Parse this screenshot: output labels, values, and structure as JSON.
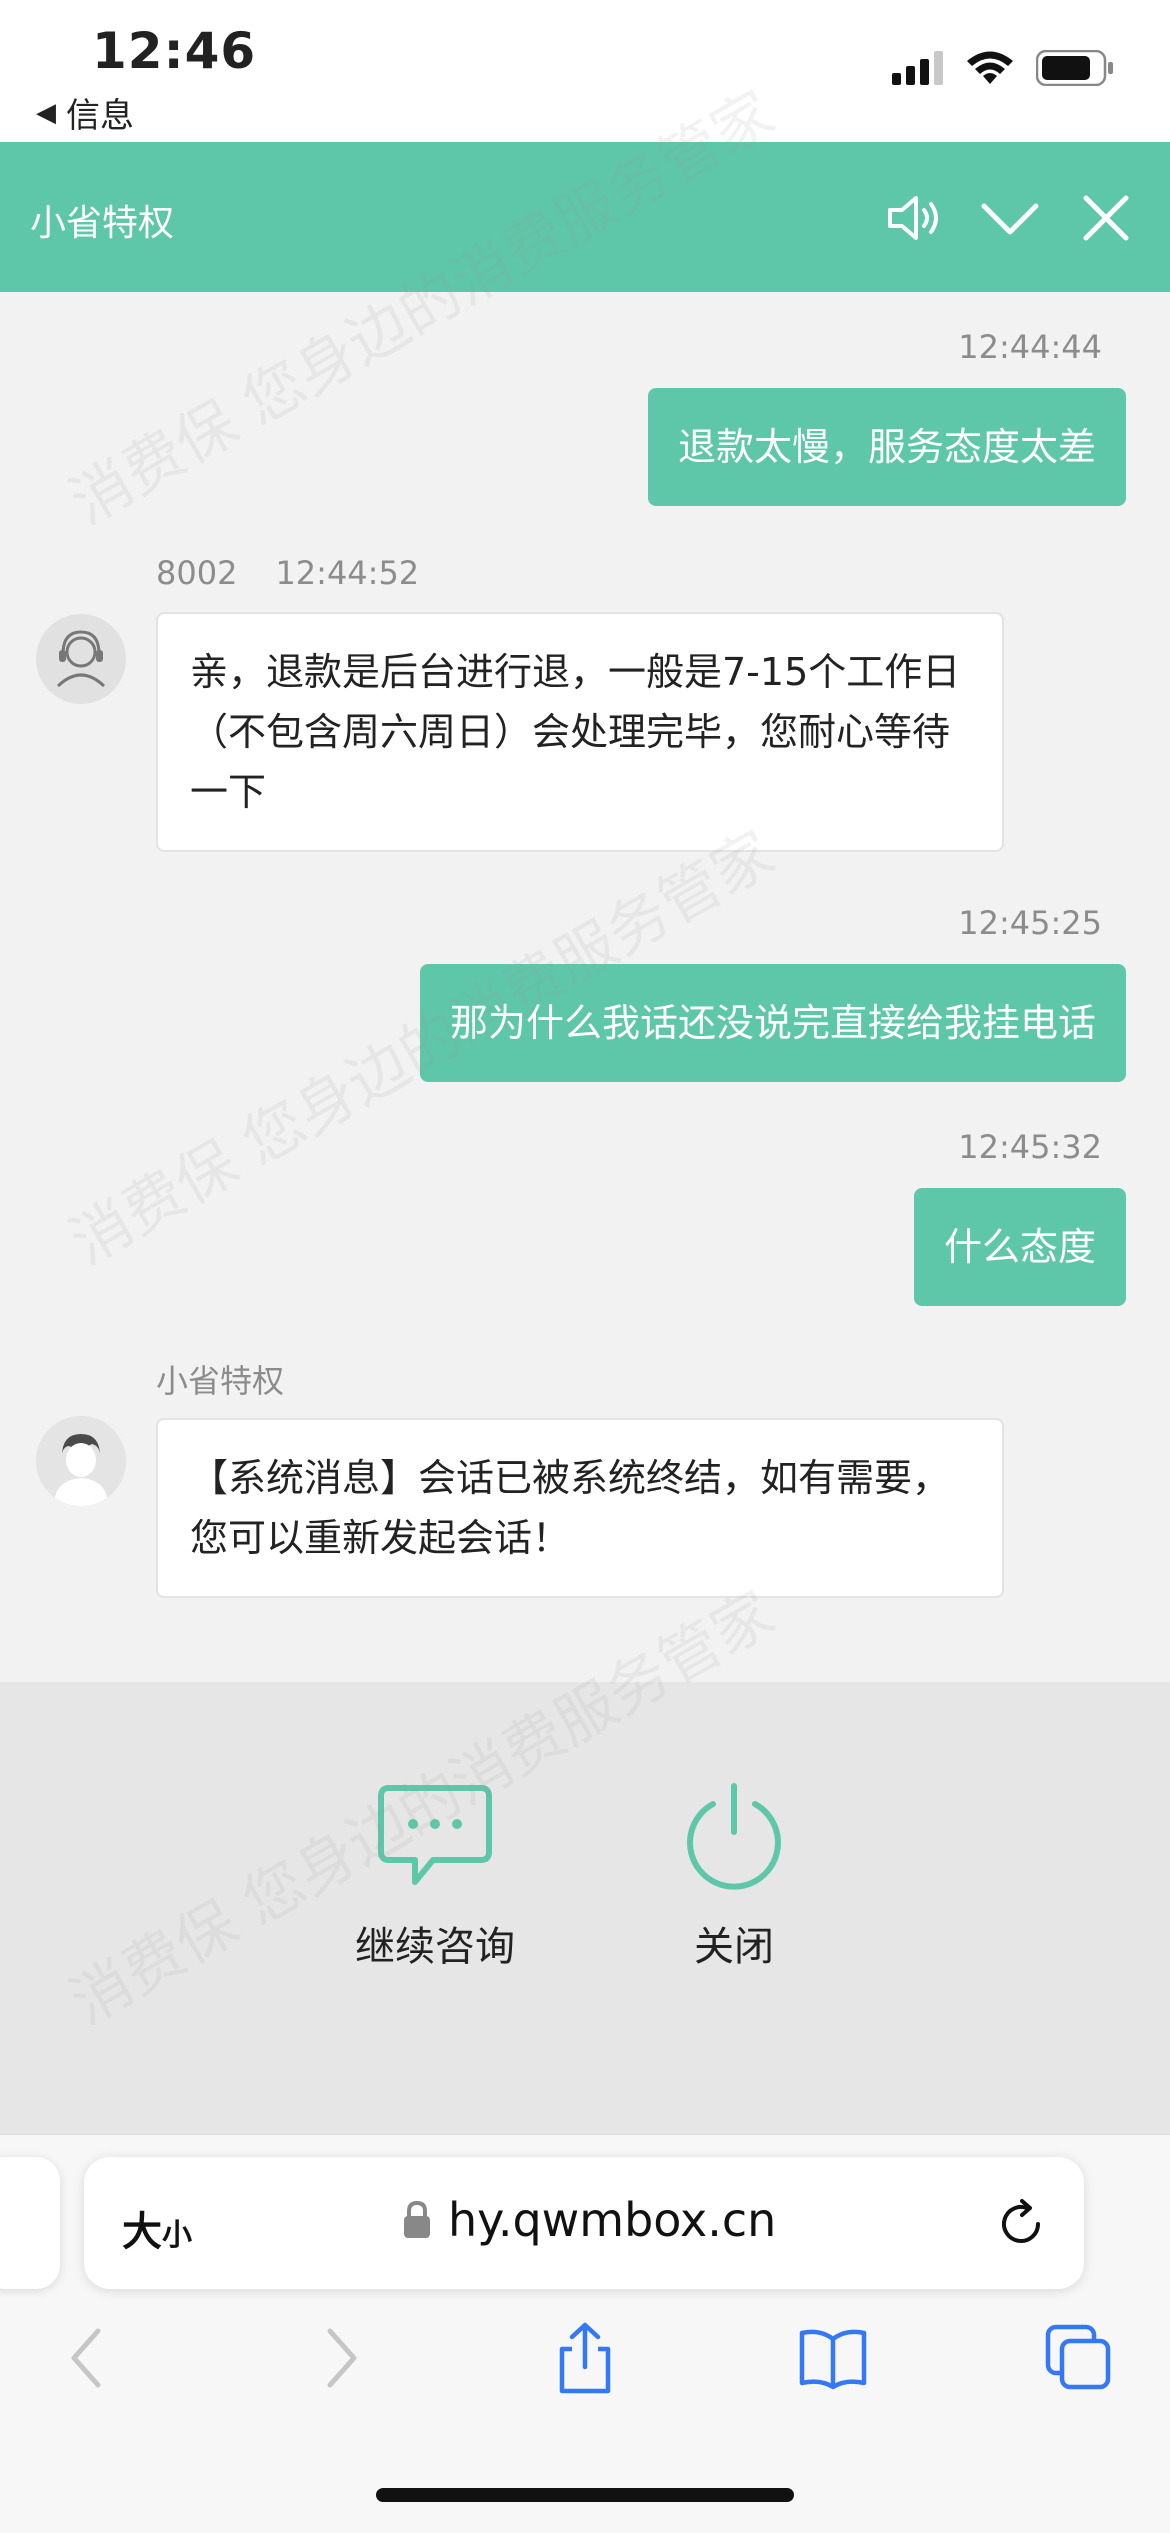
{
  "status_bar": {
    "time": "12:46",
    "back_label": "信息"
  },
  "header": {
    "title": "小省特权"
  },
  "messages": {
    "m1": {
      "time": "12:44:44",
      "text": "退款太慢，服务态度太差"
    },
    "m2": {
      "agent_id": "8002",
      "time": "12:44:52",
      "text": "亲，退款是后台进行退，一般是7-15个工作日（不包含周六周日）会处理完毕，您耐心等待一下"
    },
    "m3": {
      "time": "12:45:25",
      "text": "那为什么我话还没说完直接给我挂电话"
    },
    "m4": {
      "time": "12:45:32",
      "text": "什么态度"
    },
    "m5": {
      "sender": "小省特权",
      "text": "【系统消息】会话已被系统终结，如有需要，您可以重新发起会话！"
    }
  },
  "actions": {
    "continue_label": "继续咨询",
    "close_label": "关闭"
  },
  "browser": {
    "text_size_big": "大",
    "text_size_small": "小",
    "url": "hy.qwmbox.cn"
  },
  "watermark_text": "消费保 您身边的消费服务管家",
  "colors": {
    "accent": "#5fc7a9",
    "background": "#f2f2f2",
    "ios_blue": "#3478f6"
  }
}
